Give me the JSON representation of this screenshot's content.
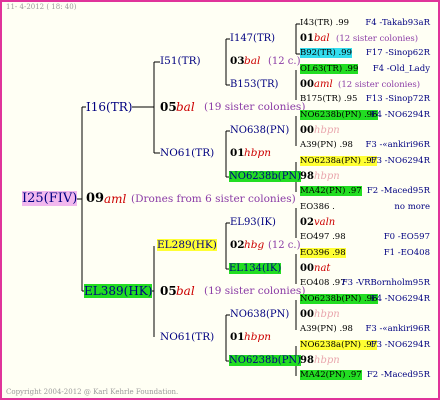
{
  "header": {
    "date": "11- 4-2012 ( 18: 40)"
  },
  "footer": {
    "copyright": "Copyright 2004-2012 @ Karl Kehrle Foundation."
  },
  "root": {
    "id": "I25(FIV)",
    "gen": "09",
    "race": "aml",
    "note": "(Drones from 6 sister colonies)"
  },
  "g1": [
    {
      "id": "I16(TR)",
      "gen": "05",
      "race": "bal",
      "note": "(19 sister colonies)"
    },
    {
      "id": "EL389(HK)",
      "gen": "05",
      "race": "bal",
      "note": "(19 sister colonies)"
    }
  ],
  "g2": [
    {
      "id": "I51(TR)",
      "gen": "03",
      "race": "bal",
      "note": "(12 c.)"
    },
    {
      "id": "NO61(TR)",
      "gen": "01",
      "race": "hbpn"
    },
    {
      "id": "EL289(HK)",
      "gen": "02",
      "race": "hbg",
      "note": "(12 c.)"
    },
    {
      "id": "NO61(TR)",
      "gen": "01",
      "race": "hbpn"
    }
  ],
  "g3": [
    {
      "id": "I147(TR)",
      "gen": "01",
      "race": "bal",
      "note": "(12 sister colonies)"
    },
    {
      "id": "B153(TR)",
      "gen": "00",
      "race": "aml",
      "note": "(12 sister colonies)"
    },
    {
      "id": "NO638(PN)",
      "gen": "00",
      "race": "hbpn"
    },
    {
      "id": "NO6238b(PN)",
      "gen": "98",
      "race": "hbpn"
    },
    {
      "id": "EL93(IK)",
      "gen": "02",
      "race": "valn"
    },
    {
      "id": "EL134(IK)",
      "gen": "00",
      "race": "nat"
    },
    {
      "id": "NO638(PN)",
      "gen": "00",
      "race": "hbpn"
    },
    {
      "id": "NO6238b(PN)",
      "gen": "98",
      "race": "hbpn"
    }
  ],
  "g4": [
    {
      "left": "I43(TR) .99",
      "right": "F4 -Takab93aR"
    },
    {
      "left": "B92(TR) .99",
      "right": "F17 -Sinop62R"
    },
    {
      "left": "OL63(TR) .99",
      "right": "F4 -Old_Lady"
    },
    {
      "left": "B175(TR) .95",
      "right": "F13 -Sinop72R"
    },
    {
      "left": "NO6238b(PN) .96",
      "right": "F4 -NO6294R"
    },
    {
      "left": "A39(PN) .98",
      "right": "F3 -«ankiri96R"
    },
    {
      "left": "NO6238a(PN) .97",
      "right": "F3 -NO6294R"
    },
    {
      "left": "MA42(PN) .97",
      "right": "F2 -Maced95R"
    },
    {
      "left": "EO386 .",
      "right": "no more"
    },
    {
      "left": "EO497 .98",
      "right": "F0 -EO597"
    },
    {
      "left": "EO396 .98",
      "right": "F1 -EO408"
    },
    {
      "left": "EO408 .97",
      "right": "F3 -VRBornholm95R"
    },
    {
      "left": "NO6238b(PN) .96",
      "right": "F4 -NO6294R"
    },
    {
      "left": "A39(PN) .98",
      "right": "F3 -«ankiri96R"
    },
    {
      "left": "NO6238a(PN) .97",
      "right": "F3 -NO6294R"
    },
    {
      "left": "MA42(PN) .97",
      "right": "F2 -Maced95R"
    }
  ]
}
